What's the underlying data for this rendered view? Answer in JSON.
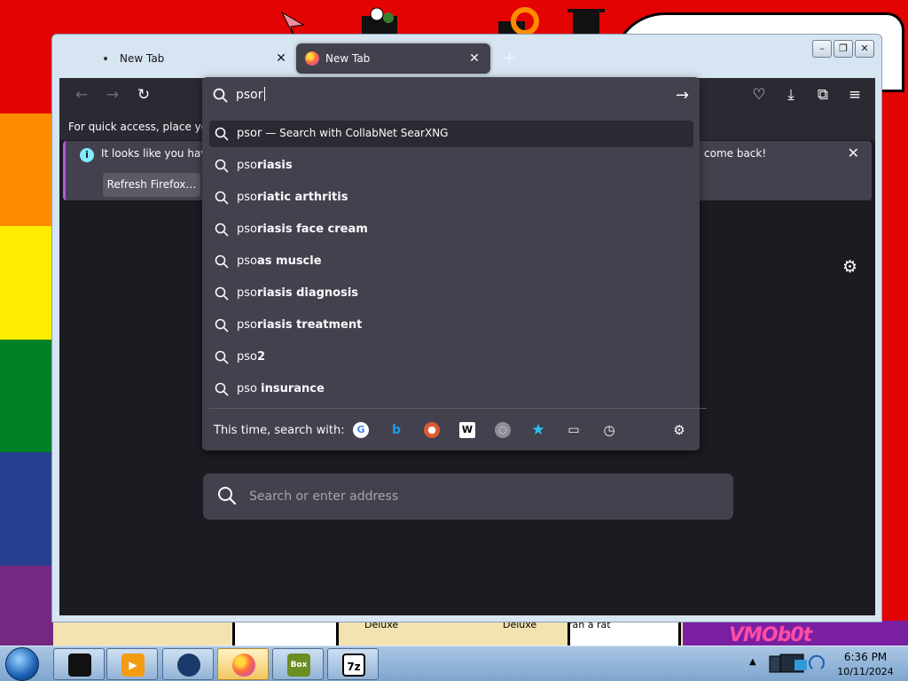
{
  "desktop": {
    "captions": [
      "Deluxe",
      "Deluxe",
      "ran a rat"
    ],
    "brand": "VMOb0t",
    "stripe_colors": [
      "#e40303",
      "#ff8c00",
      "#ffed00",
      "#008026",
      "#24408e",
      "#732982"
    ]
  },
  "browser": {
    "tabs": [
      {
        "title": "New Tab",
        "active": false
      },
      {
        "title": "New Tab",
        "active": true
      }
    ],
    "toolbar": {
      "back_icon": "←",
      "forward_icon": "→",
      "reload_icon": "↻",
      "pocket_icon": "♡",
      "download_icon": "⤓",
      "extensions_icon": "⧉",
      "menu_icon": "≡"
    },
    "bookmarks_hint": "For quick access, place your b",
    "notice": {
      "text_left": "It looks like you haven",
      "text_right": "come back!",
      "button": "Refresh Firefox…"
    },
    "page_search": {
      "placeholder": "Search or enter address"
    }
  },
  "urlbar": {
    "typed": "psor",
    "suggestions": [
      {
        "prefix": "psor",
        "bold": "",
        "action": "— Search with CollabNet SearXNG",
        "selected": true
      },
      {
        "prefix": "pso",
        "bold": "riasis"
      },
      {
        "prefix": "pso",
        "bold": "riatic arthritis"
      },
      {
        "prefix": "pso",
        "bold": "riasis face cream"
      },
      {
        "prefix": "pso",
        "bold": "as muscle"
      },
      {
        "prefix": "pso",
        "bold": "riasis diagnosis"
      },
      {
        "prefix": "pso",
        "bold": "riasis treatment"
      },
      {
        "prefix": "pso",
        "bold": "2"
      },
      {
        "prefix": "pso ",
        "bold": "insurance"
      }
    ],
    "oneoff_label": "This time, search with:",
    "engines": [
      "google-icon",
      "bing-icon",
      "duckduckgo-icon",
      "wikipedia-icon",
      "searxng-icon",
      "bookmarks-icon",
      "tabs-icon",
      "history-icon"
    ]
  },
  "taskbar": {
    "apps": [
      "terminal",
      "media-player",
      "globe",
      "firefox",
      "box-game",
      "7zip"
    ],
    "app_7z": "7z",
    "time": "6:36 PM",
    "date": "10/11/2024"
  }
}
